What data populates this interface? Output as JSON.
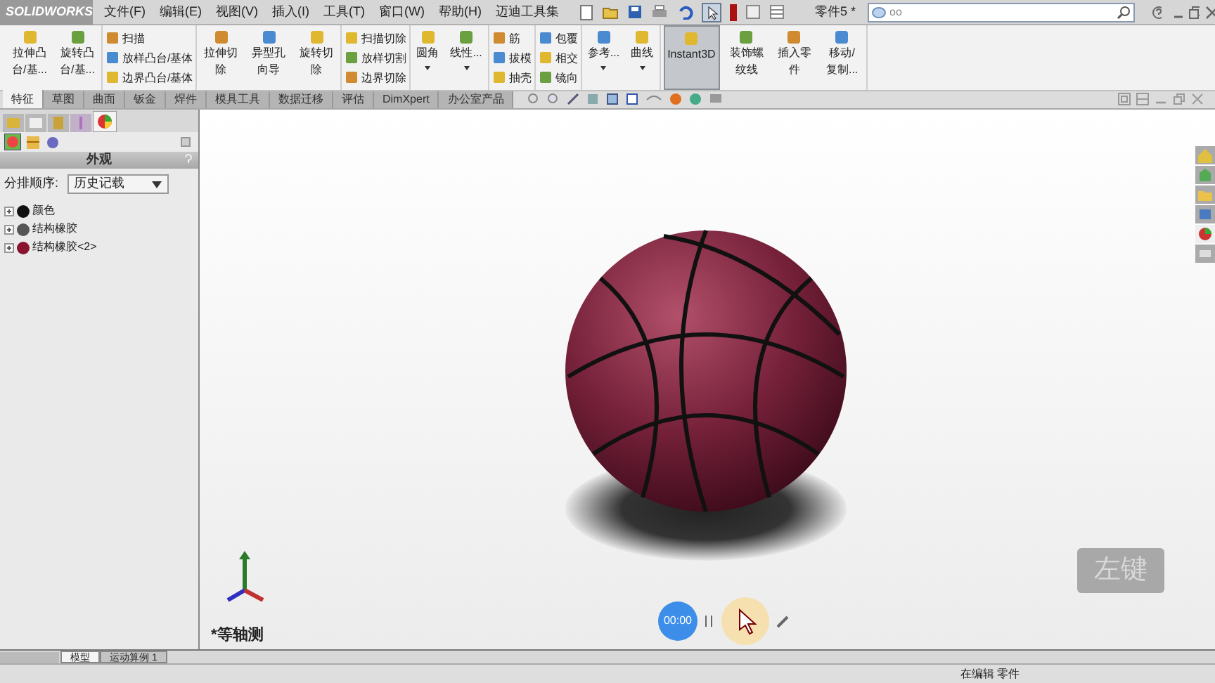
{
  "app": {
    "logo": "SOLIDWORKS",
    "menus": [
      "文件(F)",
      "编辑(E)",
      "视图(V)",
      "插入(I)",
      "工具(T)",
      "窗口(W)",
      "帮助(H)",
      "迈迪工具集"
    ],
    "document": "零件5 *",
    "search": {
      "value": "oo"
    }
  },
  "ribbon": {
    "groups": [
      {
        "kind": "large",
        "items": [
          {
            "label": "拉伸凸台/基..."
          },
          {
            "label": "旋转凸台/基..."
          }
        ]
      },
      {
        "kind": "small",
        "items": [
          {
            "label": "扫描"
          },
          {
            "label": "放样凸台/基体"
          },
          {
            "label": "边界凸台/基体"
          }
        ]
      },
      {
        "kind": "large",
        "items": [
          {
            "label": "拉伸切除"
          },
          {
            "label": "异型孔向导"
          },
          {
            "label": "旋转切除"
          }
        ]
      },
      {
        "kind": "small",
        "items": [
          {
            "label": "扫描切除"
          },
          {
            "label": "放样切割"
          },
          {
            "label": "边界切除"
          }
        ]
      },
      {
        "kind": "large",
        "items": [
          {
            "label": "圆角",
            "dropdown": true
          },
          {
            "label": "线性...",
            "dropdown": true
          }
        ]
      },
      {
        "kind": "small",
        "items": [
          {
            "label": "筋"
          },
          {
            "label": "拔模"
          },
          {
            "label": "抽壳"
          }
        ]
      },
      {
        "kind": "small",
        "items": [
          {
            "label": "包覆"
          },
          {
            "label": "相交"
          },
          {
            "label": "镜向"
          }
        ]
      },
      {
        "kind": "large",
        "items": [
          {
            "label": "参考...",
            "dropdown": true
          },
          {
            "label": "曲线",
            "dropdown": true
          }
        ]
      },
      {
        "kind": "large",
        "items": [
          {
            "label": "Instant3D",
            "selected": true
          },
          {
            "label": "装饰螺纹线",
            "selected": false
          },
          {
            "label": "插入零件",
            "selected": false
          },
          {
            "label": "移动/复制...",
            "selected": false
          }
        ]
      }
    ]
  },
  "tabs": [
    {
      "label": "特征",
      "selected": true
    },
    {
      "label": "草图",
      "selected": false
    },
    {
      "label": "曲面",
      "selected": false
    },
    {
      "label": "钣金",
      "selected": false
    },
    {
      "label": "焊件",
      "selected": false
    },
    {
      "label": "模具工具",
      "selected": false
    },
    {
      "label": "数据迁移",
      "selected": false
    },
    {
      "label": "评估",
      "selected": false
    },
    {
      "label": "DimXpert",
      "selected": false
    },
    {
      "label": "办公室产品",
      "selected": false
    }
  ],
  "panel": {
    "title": "外观",
    "sort_label": "分排顺序:",
    "sort_value": "历史记载",
    "tree": [
      {
        "label": "颜色",
        "color": "#111111"
      },
      {
        "label": "结构橡胶",
        "color": "#555555"
      },
      {
        "label": "结构橡胶<2>",
        "color": "#8a1330"
      }
    ]
  },
  "viewport": {
    "view_name": "*等轴测",
    "key_overlay": "左键",
    "recorder_time": "00:00"
  },
  "bottom_tabs": [
    {
      "label": "模型",
      "selected": true
    },
    {
      "label": "运动算例 1",
      "selected": false
    }
  ],
  "status_bar": {
    "text": "在编辑 零件"
  }
}
